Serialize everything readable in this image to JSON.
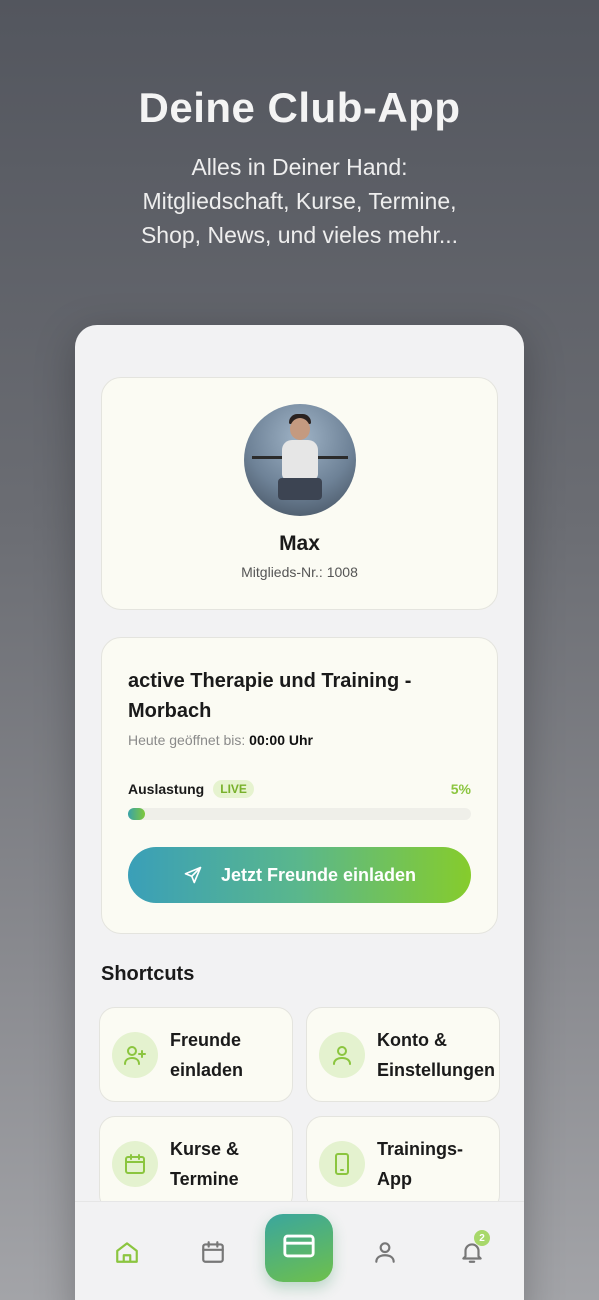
{
  "hero": {
    "title": "Deine Club-App",
    "subtitle": "Alles in Deiner Hand:\nMitgliedschaft, Kurse, Termine,\nShop, News, und vieles mehr..."
  },
  "profile": {
    "name": "Max",
    "member_number": "Mitglieds-Nr.: 1008"
  },
  "studio": {
    "title": "active Therapie und Training - Morbach",
    "open_label": "Heute geöffnet bis:",
    "open_time": "00:00 Uhr",
    "load_label": "Auslastung",
    "live_badge": "LIVE",
    "load_percent_text": "5%",
    "load_fraction": 0.05,
    "invite_button": "Jetzt Freunde einladen"
  },
  "shortcuts": {
    "title": "Shortcuts",
    "items": [
      {
        "label": "Freunde\neinladen",
        "icon": "user-plus-icon"
      },
      {
        "label": "Konto &\nEinstellungen",
        "icon": "user-icon"
      },
      {
        "label": "Kurse &\nTermine",
        "icon": "calendar-icon"
      },
      {
        "label": "Trainings-\nApp",
        "icon": "phone-icon"
      }
    ]
  },
  "navbar": {
    "items": [
      "home-icon",
      "calendar-icon",
      "card-icon",
      "user-icon",
      "bell-icon"
    ],
    "notification_count": "2"
  },
  "colors": {
    "accent_green": "#8bc53f",
    "accent_teal": "#3a9fb8",
    "card_bg": "#fbfbf3"
  }
}
